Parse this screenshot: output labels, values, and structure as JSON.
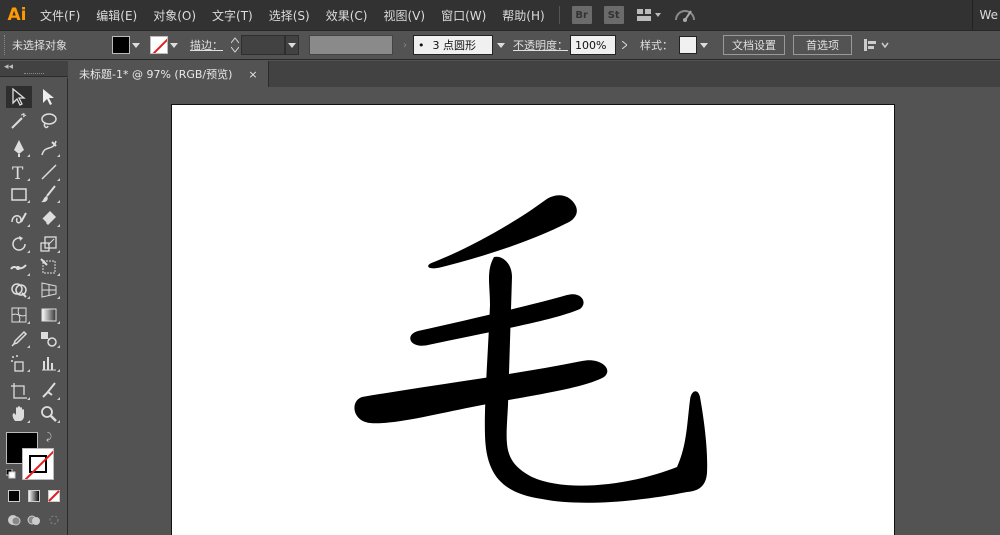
{
  "app": {
    "logo": "Ai",
    "menu": [
      "文件(F)",
      "编辑(E)",
      "对象(O)",
      "文字(T)",
      "选择(S)",
      "效果(C)",
      "视图(V)",
      "窗口(W)",
      "帮助(H)"
    ],
    "badges": [
      "Br",
      "St"
    ],
    "right_text": "We"
  },
  "control": {
    "selection_status": "未选择对象",
    "stroke_label": "描边：",
    "brush_value": "3 点圆形",
    "opacity_label": "不透明度：",
    "opacity_value": "100%",
    "style_label": "样式：",
    "doc_setup_label": "文档设置",
    "preferences_label": "首选项"
  },
  "document": {
    "tab_title": "未标题-1* @ 97% (RGB/预览)",
    "close_glyph": "×"
  },
  "tools": [
    [
      "selection-tool-icon",
      "direct-selection-tool-icon"
    ],
    [
      "magic-wand-tool-icon",
      "lasso-tool-icon"
    ],
    [
      "pen-tool-icon",
      "curvature-tool-icon"
    ],
    [
      "type-tool-icon",
      "line-segment-tool-icon"
    ],
    [
      "rectangle-tool-icon",
      "paintbrush-tool-icon"
    ],
    [
      "shaper-tool-icon",
      "eraser-tool-icon"
    ],
    [
      "rotate-tool-icon",
      "scale-tool-icon"
    ],
    [
      "width-tool-icon",
      "free-transform-tool-icon"
    ],
    [
      "shape-builder-tool-icon",
      "perspective-grid-tool-icon"
    ],
    [
      "mesh-tool-icon",
      "gradient-tool-icon"
    ],
    [
      "eyedropper-tool-icon",
      "blend-tool-icon"
    ],
    [
      "symbol-sprayer-tool-icon",
      "column-graph-tool-icon"
    ],
    [
      "artboard-tool-icon",
      "slice-tool-icon"
    ],
    [
      "hand-tool-icon",
      "zoom-tool-icon"
    ]
  ],
  "colors": {
    "accent": "#ff9a00",
    "fill": "#000000",
    "stroke": "#ffffff",
    "none_slash": "#e02020"
  }
}
